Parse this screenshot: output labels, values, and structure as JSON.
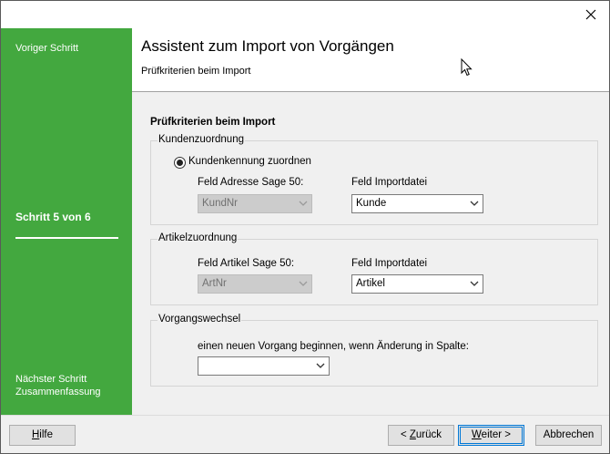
{
  "sidebar": {
    "previous_step": "Voriger Schritt",
    "step_indicator": "Schritt 5 von 6",
    "next_step_label": "Nächster Schritt",
    "next_step_value": "Zusammenfassung"
  },
  "header": {
    "title": "Assistent zum Import von Vorgängen",
    "subtitle": "Prüfkriterien beim Import"
  },
  "content": {
    "section_title": "Prüfkriterien beim Import",
    "customer_group": {
      "label": "Kundenzuordnung",
      "radio_label": "Kundenkennung zuordnen",
      "radio_checked": true,
      "left_label": "Feld Adresse Sage 50:",
      "right_label": "Feld Importdatei",
      "left_value": "KundNr",
      "right_value": "Kunde"
    },
    "article_group": {
      "label": "Artikelzuordnung",
      "left_label": "Feld Artikel Sage 50:",
      "right_label": "Feld Importdatei",
      "left_value": "ArtNr",
      "right_value": "Artikel"
    },
    "change_group": {
      "label": "Vorgangswechsel",
      "description": "einen neuen Vorgang beginnen, wenn Änderung in Spalte:",
      "value": ""
    }
  },
  "footer": {
    "help": {
      "accel": "H",
      "rest": "ilfe"
    },
    "back": {
      "prefix": "< ",
      "accel": "Z",
      "rest": "urück"
    },
    "next": {
      "accel": "W",
      "rest": "eiter >"
    },
    "cancel": "Abbrechen"
  },
  "colors": {
    "sidebar": "#43a83f",
    "default_button_border": "#0078d7"
  },
  "icons": [
    "close-icon",
    "chevron-down-icon",
    "mouse-cursor-icon"
  ]
}
